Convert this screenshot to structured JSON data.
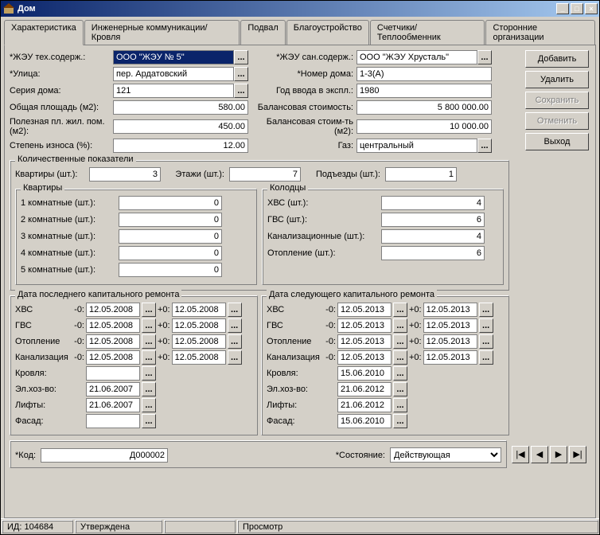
{
  "window": {
    "title": "Дом",
    "min_icon": "_",
    "max_icon": "□",
    "close_icon": "×"
  },
  "tabs": {
    "t0": "Характеристика",
    "t1": "Инженерные коммуникации/Кровля",
    "t2": "Подвал",
    "t3": "Благоустройство",
    "t4": "Счетчики/Теплообменник",
    "t5": "Сторонние организации"
  },
  "buttons": {
    "add": "Добавить",
    "delete": "Удалить",
    "save": "Сохранить",
    "cancel": "Отменить",
    "exit": "Выход"
  },
  "fields": {
    "zeu_tech_lbl": "*ЖЭУ тех.содерж.:",
    "zeu_tech_val": "ООО \"ЖЭУ № 5\"",
    "street_lbl": "*Улица:",
    "street_val": "пер. Ардатовский",
    "series_lbl": "Серия дома:",
    "series_val": "121",
    "area_lbl": "Общая площадь (м2):",
    "area_val": "580.00",
    "usable_lbl": "Полезная пл. жил. пом. (м2):",
    "usable_val": "450.00",
    "wear_lbl": "Степень износа (%):",
    "wear_val": "12.00",
    "zeu_san_lbl": "*ЖЭУ сан.содерж.:",
    "zeu_san_val": "ООО \"ЖЭУ Хрусталь\"",
    "house_lbl": "*Номер дома:",
    "house_val": "1-3(А)",
    "year_lbl": "Год ввода в экспл.:",
    "year_val": "1980",
    "balance_lbl": "Балансовая стоимость:",
    "balance_val": "5 800 000.00",
    "balance_m2_lbl": "Балансовая стоим-ть (м2):",
    "balance_m2_val": "10 000.00",
    "gas_lbl": "Газ:",
    "gas_val": "центральный"
  },
  "quant": {
    "title": "Количественные показатели",
    "apts_lbl": "Квартиры (шт.):",
    "apts_val": "3",
    "floors_lbl": "Этажи (шт.):",
    "floors_val": "7",
    "entr_lbl": "Подъезды (шт.):",
    "entr_val": "1",
    "apt_group": "Квартиры",
    "apt1_lbl": "1 комнатные (шт.):",
    "apt1_val": "0",
    "apt2_lbl": "2 комнатные (шт.):",
    "apt2_val": "0",
    "apt3_lbl": "3 комнатные (шт.):",
    "apt3_val": "0",
    "apt4_lbl": "4 комнатные (шт.):",
    "apt4_val": "0",
    "apt5_lbl": "5 комнатные (шт.):",
    "apt5_val": "0",
    "well_group": "Колодцы",
    "hvs_lbl": "ХВС (шт.):",
    "hvs_val": "4",
    "gvs_lbl": "ГВС (шт.):",
    "gvs_val": "6",
    "sew_lbl": "Канализационные (шт.):",
    "sew_val": "4",
    "heat_lbl": "Отопление (шт.):",
    "heat_val": "6"
  },
  "last_repair": {
    "title": "Дата последнего капитального ремонта",
    "hvs_lbl": "ХВС",
    "hvs_n": "-0:",
    "hvs_d1": "12.05.2008",
    "hvs_p": "+0:",
    "hvs_d2": "12.05.2008",
    "gvs_lbl": "ГВС",
    "gvs_n": "-0:",
    "gvs_d1": "12.05.2008",
    "gvs_p": "+0:",
    "gvs_d2": "12.05.2008",
    "heat_lbl": "Отопление",
    "heat_n": "-0:",
    "heat_d1": "12.05.2008",
    "heat_p": "+0:",
    "heat_d2": "12.05.2008",
    "sew_lbl": "Канализация",
    "sew_n": "-0:",
    "sew_d1": "12.05.2008",
    "sew_p": "+0:",
    "sew_d2": "12.05.2008",
    "roof_lbl": "Кровля:",
    "roof_d": "",
    "elec_lbl": "Эл.хоз-во:",
    "elec_d": "21.06.2007",
    "lift_lbl": "Лифты:",
    "lift_d": "21.06.2007",
    "facade_lbl": "Фасад:",
    "facade_d": ""
  },
  "next_repair": {
    "title": "Дата следующего капитального ремонта",
    "hvs_lbl": "ХВС",
    "hvs_n": "-0:",
    "hvs_d1": "12.05.2013",
    "hvs_p": "+0:",
    "hvs_d2": "12.05.2013",
    "gvs_lbl": "ГВС",
    "gvs_n": "-0:",
    "gvs_d1": "12.05.2013",
    "gvs_p": "+0:",
    "gvs_d2": "12.05.2013",
    "heat_lbl": "Отопление",
    "heat_n": "-0:",
    "heat_d1": "12.05.2013",
    "heat_p": "+0:",
    "heat_d2": "12.05.2013",
    "sew_lbl": "Канализация",
    "sew_n": "-0:",
    "sew_d1": "12.05.2013",
    "sew_p": "+0:",
    "sew_d2": "12.05.2013",
    "roof_lbl": "Кровля:",
    "roof_d": "15.06.2010",
    "elec_lbl": "Эл.хоз-во:",
    "elec_d": "21.06.2012",
    "lift_lbl": "Лифты:",
    "lift_d": "21.06.2012",
    "facade_lbl": "Фасад:",
    "facade_d": "15.06.2010"
  },
  "bottom": {
    "code_lbl": "*Код:",
    "code_val": "Д000002",
    "state_lbl": "*Состояние:",
    "state_val": "Действующая"
  },
  "status": {
    "id": "ИД: 104684",
    "status": "Утверждена",
    "mode": "Просмотр"
  },
  "nav": {
    "first": "|◀",
    "prev": "◀",
    "next": "▶",
    "last": "▶|"
  },
  "dots": "..."
}
